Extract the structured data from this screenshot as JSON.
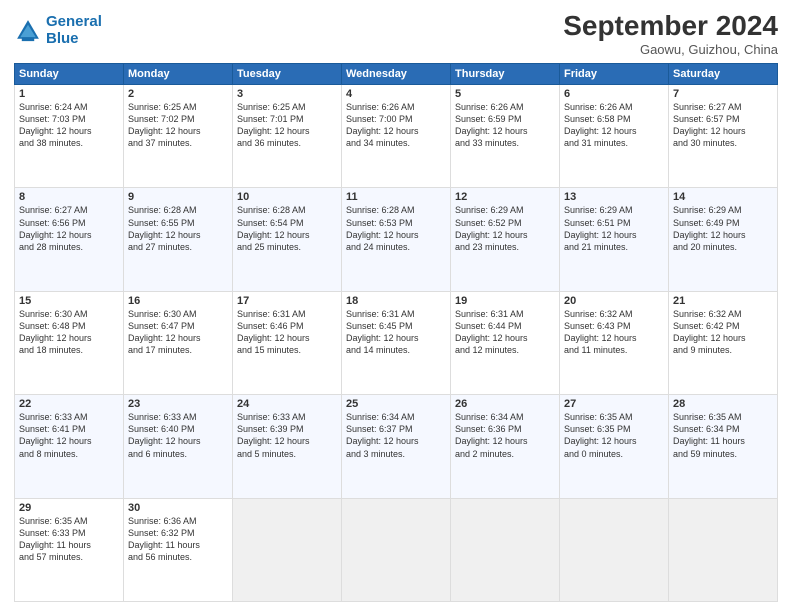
{
  "header": {
    "logo_line1": "General",
    "logo_line2": "Blue",
    "month": "September 2024",
    "location": "Gaowu, Guizhou, China"
  },
  "weekdays": [
    "Sunday",
    "Monday",
    "Tuesday",
    "Wednesday",
    "Thursday",
    "Friday",
    "Saturday"
  ],
  "weeks": [
    [
      {
        "day": "1",
        "info": "Sunrise: 6:24 AM\nSunset: 7:03 PM\nDaylight: 12 hours\nand 38 minutes."
      },
      {
        "day": "2",
        "info": "Sunrise: 6:25 AM\nSunset: 7:02 PM\nDaylight: 12 hours\nand 37 minutes."
      },
      {
        "day": "3",
        "info": "Sunrise: 6:25 AM\nSunset: 7:01 PM\nDaylight: 12 hours\nand 36 minutes."
      },
      {
        "day": "4",
        "info": "Sunrise: 6:26 AM\nSunset: 7:00 PM\nDaylight: 12 hours\nand 34 minutes."
      },
      {
        "day": "5",
        "info": "Sunrise: 6:26 AM\nSunset: 6:59 PM\nDaylight: 12 hours\nand 33 minutes."
      },
      {
        "day": "6",
        "info": "Sunrise: 6:26 AM\nSunset: 6:58 PM\nDaylight: 12 hours\nand 31 minutes."
      },
      {
        "day": "7",
        "info": "Sunrise: 6:27 AM\nSunset: 6:57 PM\nDaylight: 12 hours\nand 30 minutes."
      }
    ],
    [
      {
        "day": "8",
        "info": "Sunrise: 6:27 AM\nSunset: 6:56 PM\nDaylight: 12 hours\nand 28 minutes."
      },
      {
        "day": "9",
        "info": "Sunrise: 6:28 AM\nSunset: 6:55 PM\nDaylight: 12 hours\nand 27 minutes."
      },
      {
        "day": "10",
        "info": "Sunrise: 6:28 AM\nSunset: 6:54 PM\nDaylight: 12 hours\nand 25 minutes."
      },
      {
        "day": "11",
        "info": "Sunrise: 6:28 AM\nSunset: 6:53 PM\nDaylight: 12 hours\nand 24 minutes."
      },
      {
        "day": "12",
        "info": "Sunrise: 6:29 AM\nSunset: 6:52 PM\nDaylight: 12 hours\nand 23 minutes."
      },
      {
        "day": "13",
        "info": "Sunrise: 6:29 AM\nSunset: 6:51 PM\nDaylight: 12 hours\nand 21 minutes."
      },
      {
        "day": "14",
        "info": "Sunrise: 6:29 AM\nSunset: 6:49 PM\nDaylight: 12 hours\nand 20 minutes."
      }
    ],
    [
      {
        "day": "15",
        "info": "Sunrise: 6:30 AM\nSunset: 6:48 PM\nDaylight: 12 hours\nand 18 minutes."
      },
      {
        "day": "16",
        "info": "Sunrise: 6:30 AM\nSunset: 6:47 PM\nDaylight: 12 hours\nand 17 minutes."
      },
      {
        "day": "17",
        "info": "Sunrise: 6:31 AM\nSunset: 6:46 PM\nDaylight: 12 hours\nand 15 minutes."
      },
      {
        "day": "18",
        "info": "Sunrise: 6:31 AM\nSunset: 6:45 PM\nDaylight: 12 hours\nand 14 minutes."
      },
      {
        "day": "19",
        "info": "Sunrise: 6:31 AM\nSunset: 6:44 PM\nDaylight: 12 hours\nand 12 minutes."
      },
      {
        "day": "20",
        "info": "Sunrise: 6:32 AM\nSunset: 6:43 PM\nDaylight: 12 hours\nand 11 minutes."
      },
      {
        "day": "21",
        "info": "Sunrise: 6:32 AM\nSunset: 6:42 PM\nDaylight: 12 hours\nand 9 minutes."
      }
    ],
    [
      {
        "day": "22",
        "info": "Sunrise: 6:33 AM\nSunset: 6:41 PM\nDaylight: 12 hours\nand 8 minutes."
      },
      {
        "day": "23",
        "info": "Sunrise: 6:33 AM\nSunset: 6:40 PM\nDaylight: 12 hours\nand 6 minutes."
      },
      {
        "day": "24",
        "info": "Sunrise: 6:33 AM\nSunset: 6:39 PM\nDaylight: 12 hours\nand 5 minutes."
      },
      {
        "day": "25",
        "info": "Sunrise: 6:34 AM\nSunset: 6:37 PM\nDaylight: 12 hours\nand 3 minutes."
      },
      {
        "day": "26",
        "info": "Sunrise: 6:34 AM\nSunset: 6:36 PM\nDaylight: 12 hours\nand 2 minutes."
      },
      {
        "day": "27",
        "info": "Sunrise: 6:35 AM\nSunset: 6:35 PM\nDaylight: 12 hours\nand 0 minutes."
      },
      {
        "day": "28",
        "info": "Sunrise: 6:35 AM\nSunset: 6:34 PM\nDaylight: 11 hours\nand 59 minutes."
      }
    ],
    [
      {
        "day": "29",
        "info": "Sunrise: 6:35 AM\nSunset: 6:33 PM\nDaylight: 11 hours\nand 57 minutes."
      },
      {
        "day": "30",
        "info": "Sunrise: 6:36 AM\nSunset: 6:32 PM\nDaylight: 11 hours\nand 56 minutes."
      },
      {
        "day": "",
        "info": ""
      },
      {
        "day": "",
        "info": ""
      },
      {
        "day": "",
        "info": ""
      },
      {
        "day": "",
        "info": ""
      },
      {
        "day": "",
        "info": ""
      }
    ]
  ]
}
